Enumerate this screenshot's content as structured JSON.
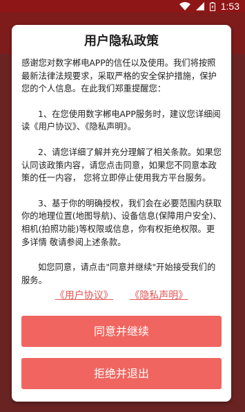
{
  "status_bar": {
    "time": "1:53",
    "icons": [
      "wifi-icon",
      "signal-icon",
      "battery-icon"
    ]
  },
  "dialog": {
    "title": "用户隐私政策",
    "paragraphs": [
      "感谢您对数字郴电APP的信任以及使用。我们将按照最新法律法规要求，采取严格的安全保护措施，保护您的个人信息。在此我们郑重提醒您：",
      "1、在您使用数字郴电APP服务时，建议您详细阅读《用户协议》、《隐私声明》。",
      "2、请您详细了解并充分理解了相关条款。如果您认同该政策内容，请您点击同意，如果您不同意本政策的任一内容， 您将立即停止使用我方平台服务。",
      "3、基于你的明确授权，我们会在必要范围内获取你的地理位置(地图导航)、设备信息(保障用户安全)、相机(拍照功能)等权限或信息，你有权拒绝权限。更多详情 敬请参阅上述条款。",
      "如您同意，请点击\"同意并继续\"开始接受我们的服务。"
    ],
    "links": {
      "user_agreement": "《用户协议》",
      "privacy_statement": "《隐私声明》"
    },
    "buttons": {
      "agree": "同意并继续",
      "reject": "拒绝并退出"
    }
  },
  "colors": {
    "status_bar": "#8f1616",
    "overlay_bg": "#6a2323",
    "button": "#f0655f",
    "link": "#e05555"
  }
}
